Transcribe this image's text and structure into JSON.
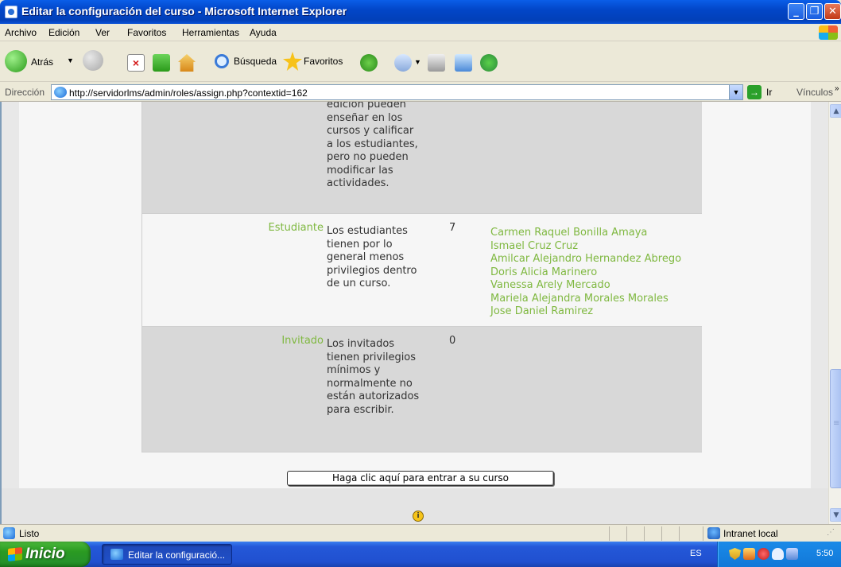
{
  "window": {
    "title": "Editar la configuración del curso - Microsoft Internet Explorer",
    "controls": {
      "minimize": "_",
      "maximize": "❐",
      "close": "✕"
    }
  },
  "menu": {
    "items": [
      "Archivo",
      "Edición",
      "Ver",
      "Favoritos",
      "Herramientas",
      "Ayuda"
    ]
  },
  "toolbar": {
    "back_label": "Atrás",
    "search_label": "Búsqueda",
    "favorites_label": "Favoritos",
    "icons": [
      "back-arrow",
      "forward-arrow",
      "stop",
      "refresh",
      "home",
      "search",
      "favorites-star",
      "history",
      "mail",
      "print",
      "edit",
      "messenger"
    ]
  },
  "address": {
    "label": "Dirección",
    "url": "http://servidorlms/admin/roles/assign.php?contextid=162",
    "go_label": "Ir",
    "links_label": "Vínculos"
  },
  "roles": {
    "teacher_desc_tail": "edición pueden enseñar en los cursos y calificar a los estudiantes, pero no pueden modificar las actividades.",
    "student": {
      "name": "Estudiante",
      "description": "Los estudiantes tienen por lo general menos privilegios dentro de un curso.",
      "count": "7",
      "users": [
        "Carmen Raquel Bonilla Amaya",
        "Ismael Cruz Cruz",
        "Amilcar Alejandro Hernandez Abrego",
        "Doris Alicia Marinero",
        "Vanessa Arely Mercado",
        "Mariela Alejandra Morales Morales",
        "Jose Daniel Ramirez"
      ]
    },
    "guest": {
      "name": "Invitado",
      "description": "Los invitados tienen privilegios mínimos y normalmente no están autorizados para escribir.",
      "count": "0"
    }
  },
  "page": {
    "enter_course_button": "Haga clic aquí para entrar a su curso",
    "help_icon_glyph": "i"
  },
  "status": {
    "text": "Listo",
    "zone": "Intranet local"
  },
  "taskbar": {
    "start_label": "Inicio",
    "task_label": "Editar la configuració...",
    "language": "ES",
    "clock": "5:50"
  },
  "colors": {
    "link_green": "#7fb840",
    "row_dark": "#d8d8d8",
    "row_light": "#f6f6f6",
    "xp_blue": "#0246c8"
  }
}
